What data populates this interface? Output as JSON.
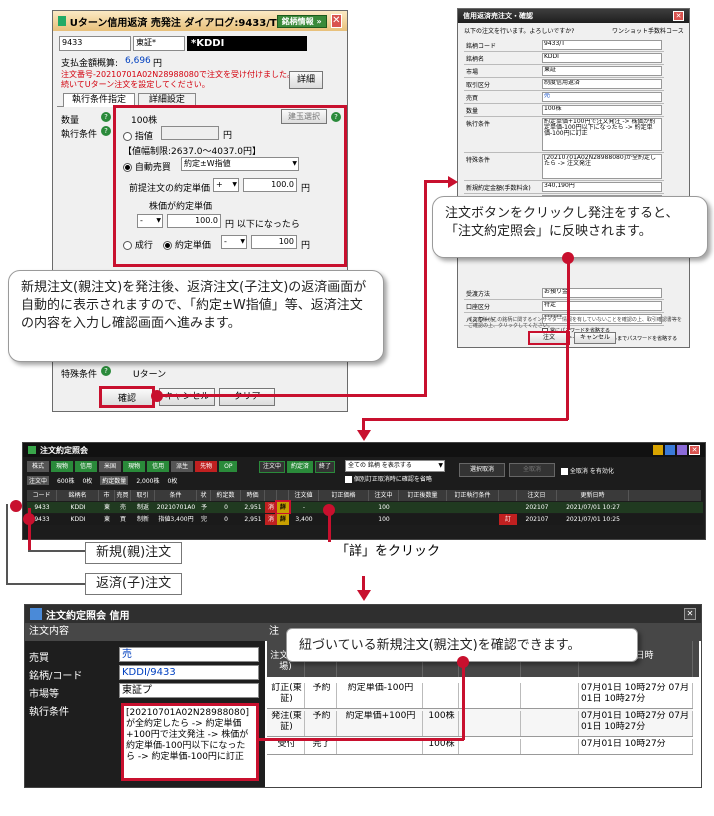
{
  "w1": {
    "title": "Uターン信用返済 売発注 ダイアログ:9433/T",
    "stock_info_btn": "銘柄情報 »",
    "code": "9433",
    "market": "東証*",
    "name": "*KDDI",
    "payment_label": "支払金額概算:",
    "payment_value": "6,696",
    "payment_unit": "円",
    "notice_line1": "注文番号-20210701A02N28988080で注文を受け付けました。",
    "notice_line2": "続いてUターン注文を設定してください。",
    "detail_btn": "詳細",
    "tab1": "執行条件指定",
    "tab2": "詳細設定",
    "qty_label": "数量",
    "qty_value": "100株",
    "pos_select_btn": "建玉選択",
    "exec_label": "執行条件",
    "limit_label": "指値",
    "limit_unit": "円",
    "price_limit": "【値幅制限:2637.0〜4037.0円】",
    "auto_label": "自動売買",
    "auto_select": "約定±W指値",
    "prev_price_label": "前提注文の約定単価",
    "plus_sign": "+",
    "prev_price_value": "100.0",
    "prev_unit": "円",
    "stock_price_label": "株価が約定単価",
    "minus_sign": "-",
    "stock_price_value": "100.0",
    "stock_price_suffix": "円 以下になったら",
    "market_order": "成行",
    "exec_price_label": "約定単価",
    "exec_minus": "-",
    "exec_value": "100",
    "exec_unit": "円",
    "special_label": "特殊条件",
    "special_value": "Uターン",
    "confirm_btn": "確認",
    "cancel_btn": "キャンセル",
    "clear_btn": "クリア"
  },
  "w2": {
    "title": "信用返済売注文・確認",
    "prompt": "以下の注文を行います。よろしいですか?",
    "one_shot": "ワンショット手数料コース",
    "rows": [
      [
        "銘柄コード",
        "9433/T"
      ],
      [
        "銘柄名",
        "KDDI"
      ],
      [
        "市場",
        "東証"
      ],
      [
        "取引区分",
        "制度信用返済"
      ],
      [
        "売買",
        "売"
      ],
      [
        "数量",
        "100株"
      ],
      [
        "執行条件",
        "約定単価+100円で注文発注 -> 株価が約定単価-100円以下になったら -> 約定単価-100円に訂正"
      ],
      [
        "特殊条件",
        "[20210701A02N28988080]が全約定したら -> 注文発注"
      ],
      [
        "新規約定金額(手数料含)",
        "340,190円"
      ],
      [
        "返済約定金額概算",
        "350,000円"
      ],
      [
        "受渡方法",
        "お預り金"
      ],
      [
        "口座区分",
        "特定"
      ],
      [
        "パスワード",
        "******"
      ]
    ],
    "check1": "常にパスワードを省略する",
    "check2": "kabuステーションを終了するまでパスワードを省略する",
    "footer_note": "※お客様がこの銘柄に関するインサイダー情報を有していないことを確認の上、取引確認書等をご確認の上、クリックしてください。",
    "order_btn": "注文",
    "cancel_btn": "キャンセル"
  },
  "w3": {
    "title": "注文約定照会",
    "filter_tabs": [
      "株式",
      "現物",
      "信用",
      "米国",
      "現物",
      "信用",
      "派生",
      "先物",
      "OP"
    ],
    "status_tabs": [
      "注文中",
      "約定済",
      "終了"
    ],
    "show_select": "全ての 銘柄 を表示する",
    "checkbox1": "個別訂正取消時に確認を省略",
    "btn_select_cancel": "選択取消",
    "btn_all_cancel": "全取消",
    "checkbox2": "全取消 を有効化",
    "summary": [
      "注文中",
      "600株",
      "0枚",
      "約定数量",
      "2,000株",
      "0枚"
    ],
    "headers": [
      "コード",
      "銘柄名",
      "市",
      "売買",
      "取引",
      "条件",
      "状",
      "約定数",
      "時価",
      "",
      "",
      "注文値",
      "訂正価格",
      "注文中",
      "訂正後数量",
      "訂正執行条件",
      "",
      "注文日",
      "更新日時"
    ],
    "rows": [
      [
        "9433",
        "KDDI",
        "東",
        "売",
        "制返",
        "20210701A0",
        "予",
        "0",
        "2,951",
        "消",
        "詳",
        "-",
        "",
        "100",
        "",
        "",
        "",
        "202107",
        "2021/07/01 10:27"
      ],
      [
        "9433",
        "KDDI",
        "東",
        "買",
        "制新",
        "指値3,400円",
        "完",
        "0",
        "2,951",
        "消",
        "詳",
        "3,400",
        "",
        "100",
        "",
        "",
        "訂",
        "202107",
        "2021/07/01 10:25"
      ]
    ]
  },
  "w4": {
    "title": "注文約定照会 信用",
    "section": "注文内容",
    "side_label": "売買",
    "side_value": "売",
    "stock_label": "銘柄/コード",
    "stock_value": "KDDI/9433",
    "market_label": "市場等",
    "market_value": "東証プ",
    "exec_label": "執行条件",
    "exec_value": "[20210701A02N28988080]が全約定したら -> 約定単価+100円で注文発注 -> 株価が約定単価-100円以下になったら -> 約定単価-100円に訂正",
    "right_tab": "注",
    "headers": [
      "注文(市場)",
      "状態",
      "単価",
      "数量",
      "受渡日",
      "消費税",
      "更新日時"
    ],
    "rows": [
      [
        "訂正(東証)",
        "予約",
        "約定単価-100円",
        "",
        "",
        "",
        "07月01日 10時27分 07月01日 10時27分"
      ],
      [
        "発注(東証)",
        "予約",
        "約定単価+100円",
        "100株",
        "",
        "",
        "07月01日 10時27分 07月01日 10時27分"
      ],
      [
        "受付",
        "完了",
        "",
        "100株",
        "",
        "",
        "07月01日 10時27分"
      ]
    ],
    "cancel_x": "✕"
  },
  "callouts": {
    "left": "新規注文(親注文)を発注後、返済注文(子注文)の返済画面が自動的に表示されますので、「約定±W指値」等、返済注文の内容を入力し確認画面へ進みます。",
    "right": "注文ボタンをクリックし発注をすると、「注文約定照会」に反映されます。",
    "detail": "「詳」をクリック",
    "parent_tag": "新規(親)注文",
    "child_tag": "返済(子)注文",
    "bottom": "紐づいている新規注文(親注文)を確認できます。"
  }
}
